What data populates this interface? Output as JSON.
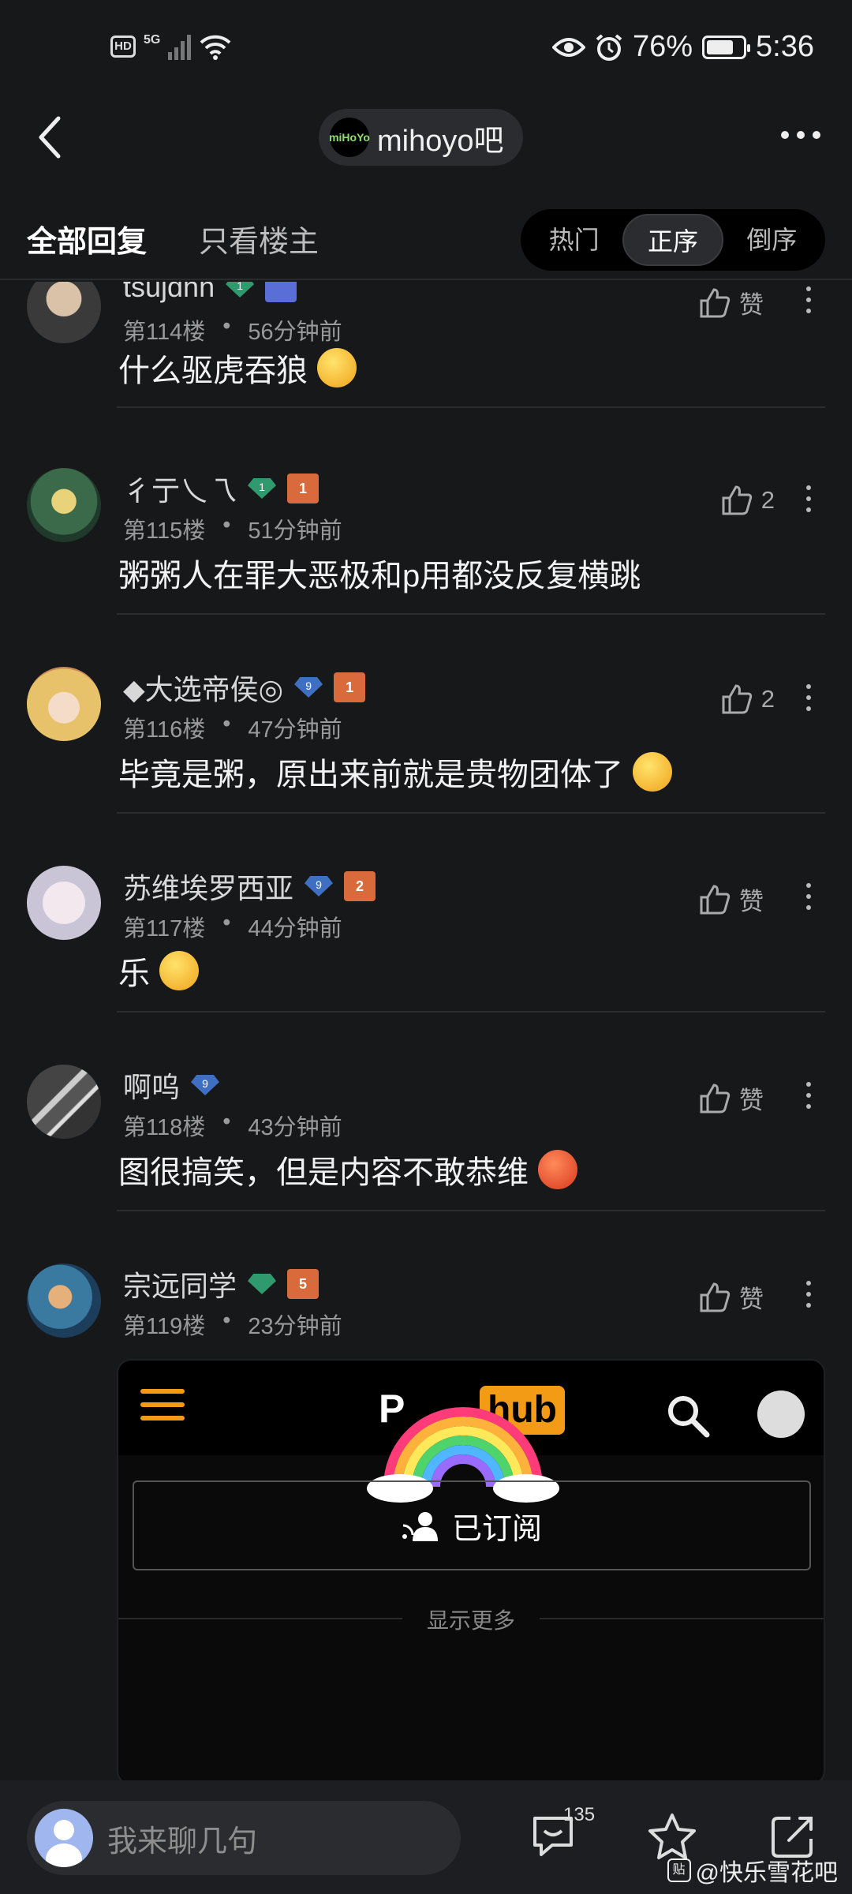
{
  "status_bar": {
    "hd": "HD",
    "network": "5G",
    "battery_percent": "76%",
    "battery_level": 0.76,
    "time": "5:36"
  },
  "header": {
    "forum_logo_text": "miHoYo",
    "forum_name": "mihoyo吧"
  },
  "tabs": {
    "all_replies": "全部回复",
    "op_only": "只看楼主"
  },
  "sort": {
    "options": [
      "热门",
      "正序",
      "倒序"
    ],
    "selected": "正序"
  },
  "posts": [
    {
      "username": "tsujdhh",
      "level_gem": "green",
      "level": "1",
      "badge": "",
      "floor": "第114楼",
      "time": "56分钟前",
      "likes": "赞",
      "content": "什么驱虎吞狼",
      "emoji": "yellow"
    },
    {
      "username": "彳亍乀乁",
      "level_gem": "green",
      "level": "1",
      "badge": "1",
      "floor": "第115楼",
      "time": "51分钟前",
      "likes": "2",
      "content": "粥粥人在罪大恶极和p用都没反复横跳",
      "emoji": ""
    },
    {
      "username": "◆大选帝侯◎",
      "level_gem": "blue",
      "level": "9",
      "badge": "1",
      "floor": "第116楼",
      "time": "47分钟前",
      "likes": "2",
      "content": "毕竟是粥，原出来前就是贵物团体了",
      "emoji": "yellow"
    },
    {
      "username": "苏维埃罗西亚",
      "level_gem": "blue",
      "level": "9",
      "badge": "2",
      "floor": "第117楼",
      "time": "44分钟前",
      "likes": "赞",
      "content": "乐",
      "emoji": "yellow"
    },
    {
      "username": "啊呜",
      "level_gem": "blue",
      "level": "9",
      "badge": "",
      "floor": "第118楼",
      "time": "43分钟前",
      "likes": "赞",
      "content": "图很搞笑，但是内容不敢恭维",
      "emoji": "red"
    },
    {
      "username": "宗远同学",
      "level_gem": "green",
      "level": "",
      "badge": "5",
      "floor": "第119楼",
      "time": "23分钟前",
      "likes": "赞",
      "content": "",
      "emoji": ""
    }
  ],
  "embedded_card": {
    "logo_left": "P",
    "logo_right": "hub",
    "subscribed_label": "已订阅",
    "show_more": "显示更多"
  },
  "bottom_bar": {
    "reply_placeholder": "我来聊几句",
    "comment_count": "135",
    "watermark": "@快乐雪花吧",
    "watermark_icon": "贴"
  },
  "colors": {
    "background": "#17181a",
    "accent_orange": "#f49b16",
    "gem_green": "#2f9a6e",
    "gem_blue": "#3f6fc0"
  }
}
